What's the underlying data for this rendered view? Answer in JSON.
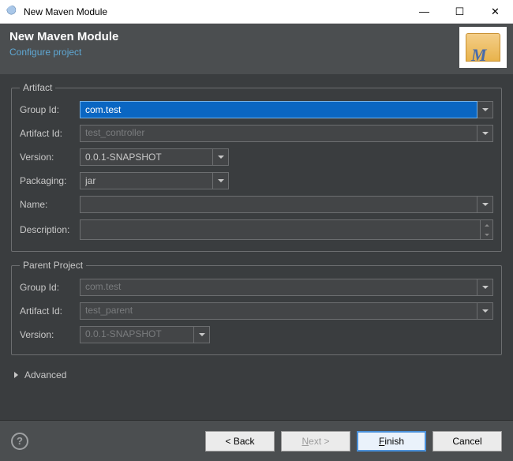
{
  "titlebar": {
    "title": "New Maven Module"
  },
  "header": {
    "title": "New Maven Module",
    "subtitle": "Configure project"
  },
  "artifact": {
    "legend": "Artifact",
    "group_id_label": "Group Id:",
    "group_id_value": "com.test",
    "artifact_id_label": "Artifact Id:",
    "artifact_id_value": "test_controller",
    "version_label": "Version:",
    "version_value": "0.0.1-SNAPSHOT",
    "packaging_label": "Packaging:",
    "packaging_value": "jar",
    "name_label": "Name:",
    "name_value": "",
    "description_label": "Description:",
    "description_value": ""
  },
  "parent": {
    "legend": "Parent Project",
    "group_id_label": "Group Id:",
    "group_id_value": "com.test",
    "artifact_id_label": "Artifact Id:",
    "artifact_id_value": "test_parent",
    "version_label": "Version:",
    "version_value": "0.0.1-SNAPSHOT"
  },
  "advanced_label": "Advanced",
  "footer": {
    "back": "< Back",
    "next_prefix": "N",
    "next_suffix": "ext >",
    "finish_prefix": "F",
    "finish_suffix": "inish",
    "cancel": "Cancel"
  }
}
